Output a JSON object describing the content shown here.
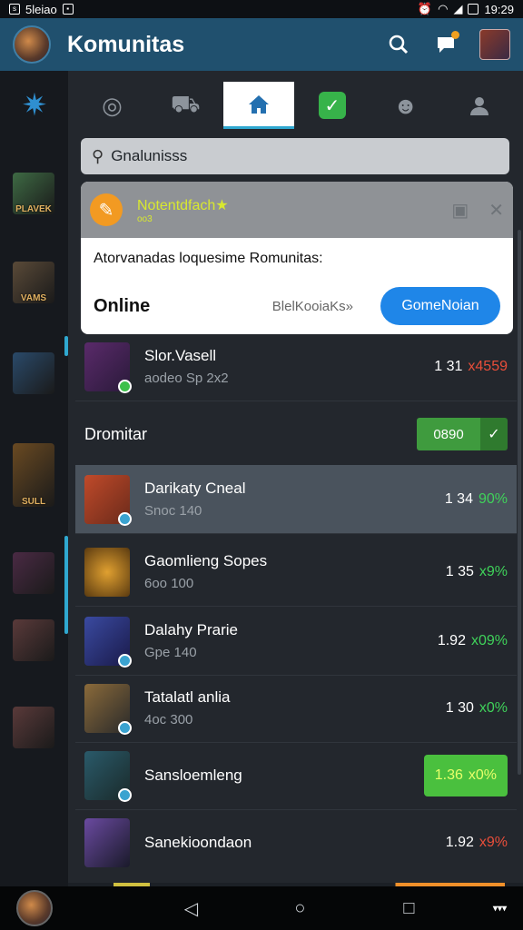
{
  "status": {
    "carrier": "5leiao",
    "time": "19:29"
  },
  "appbar": {
    "title": "Komunitas"
  },
  "sidebar": {
    "items": [
      {
        "label": "PLAVEK",
        "color": "#3e6a44"
      },
      {
        "label": "VAMS",
        "color": "#5a4a38"
      },
      {
        "label": "",
        "color": "#2a4a6a"
      },
      {
        "label": "SULL",
        "color": "#6a4a22"
      },
      {
        "label": "",
        "color": "#4a2a44"
      },
      {
        "label": "",
        "color": "#5a3a3a"
      }
    ]
  },
  "tabs": [
    {
      "icon": "target-icon"
    },
    {
      "icon": "shop-icon"
    },
    {
      "icon": "home-icon",
      "active": true
    },
    {
      "icon": "check-icon"
    },
    {
      "icon": "game-icon"
    },
    {
      "icon": "profile-icon"
    }
  ],
  "search": {
    "value": "Gnalunisss"
  },
  "popup": {
    "title": "Notentdfach★",
    "subtitle": "oo3",
    "message": "Atorvanadas loquesime Romunitas:",
    "online_label": "Online",
    "hint": "BlelKooiaKs»",
    "button": "GomeNoian"
  },
  "top_row": {
    "name": "Slor.Vasell",
    "sub": "aodeo Sp 2x2",
    "score": "1 31",
    "pct": "x4559",
    "pct_color": "red"
  },
  "section": {
    "label": "Dromitar",
    "button": "0890",
    "check": "✓"
  },
  "rows": [
    {
      "name": "Darikaty Cneal",
      "sub": "Snoc 140",
      "score": "1 34",
      "pct": "90%",
      "highlight": true
    },
    {
      "name": "Gaomlieng Sopes",
      "sub": "6oo 100",
      "score": "1 35",
      "pct": "x9%"
    },
    {
      "name": "Dalahy Prarie",
      "sub": "Gpe 140",
      "score": "1.92",
      "pct": "x09%"
    },
    {
      "name": "Tatalatl anlia",
      "sub": "4oc 300",
      "score": "1 30",
      "pct": "x0%"
    },
    {
      "name": "Sansloemleng",
      "sub": "",
      "score": "1.36",
      "pct": "x0%",
      "boxed": true
    },
    {
      "name": "Sanekioondaon",
      "sub": "",
      "score": "1.92",
      "pct": "x9%",
      "pct_color": "red"
    }
  ],
  "navbar": {
    "more": "▾▾▾"
  }
}
